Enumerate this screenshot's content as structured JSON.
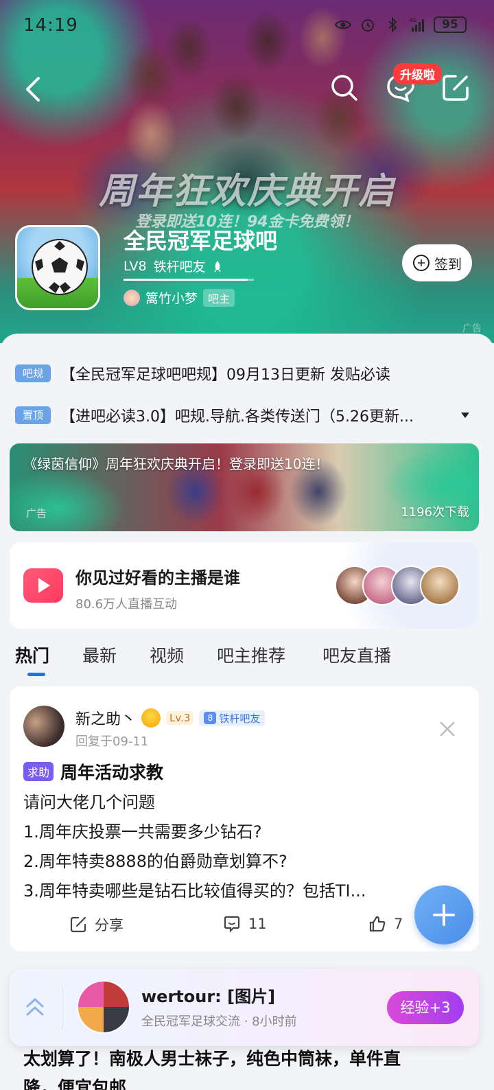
{
  "status_bar": {
    "time": "14:19",
    "battery": "95",
    "network": "4G"
  },
  "hero": {
    "banner_title": "周年狂欢庆典开启",
    "banner_subtitle": "登录即送10连！94金卡免费领！",
    "upgrade_badge": "升级啦",
    "ad_mark": "广告"
  },
  "forum": {
    "name": "全民冠军足球吧",
    "level": "LV8",
    "level_title": "铁杆吧友",
    "level_progress": 0.95,
    "owner_name": "篱竹小梦",
    "owner_tag": "吧主",
    "signin_label": "签到"
  },
  "notices": [
    {
      "badge": "吧规",
      "text": "【全民冠军足球吧吧规】09月13日更新 发贴必读"
    },
    {
      "badge": "置顶",
      "text": "【进吧必读3.0】吧规.导航.各类传送门（5.26更新..."
    }
  ],
  "ad_banner": {
    "title": "《绿茵信仰》周年狂欢庆典开启！登录即送10连！",
    "label": "广告",
    "downloads": "1196次下载"
  },
  "live_card": {
    "title": "你见过好看的主播是谁",
    "subtitle": "80.6万人直播互动"
  },
  "tabs": [
    "热门",
    "最新",
    "视频",
    "吧主推荐",
    "吧友直播"
  ],
  "post": {
    "author": "新之助丶",
    "level_badge": "Lv.3",
    "fan_level": "8",
    "fan_title": "铁杆吧友",
    "time": "回复于09-11",
    "tag": "求助",
    "title": "周年活动求教",
    "body": [
      "请问大佬几个问题",
      "1.周年庆投票一共需要多少钻石?",
      "2.周年特卖8888的伯爵勋章划算不?",
      "3.周年特卖哪些是钻石比较值得买的？包括TI..."
    ],
    "share_label": "分享",
    "comments": "11",
    "likes": "7"
  },
  "float_bar": {
    "title": "wertour: [图片]",
    "subtitle": "全民冠军足球交流 · 8小时前",
    "exp_button": "经验+3"
  },
  "next_post": {
    "title_line1": "太划算了！南极人男士袜子，纯色中筒袜，单件直",
    "title_line2": "降，便宜包邮"
  },
  "colors": {
    "accent": "#2b6de8",
    "notice_badge": "#6aa3e8",
    "help_tag": "#7b5cf0",
    "exp_button": "#c244e4"
  }
}
